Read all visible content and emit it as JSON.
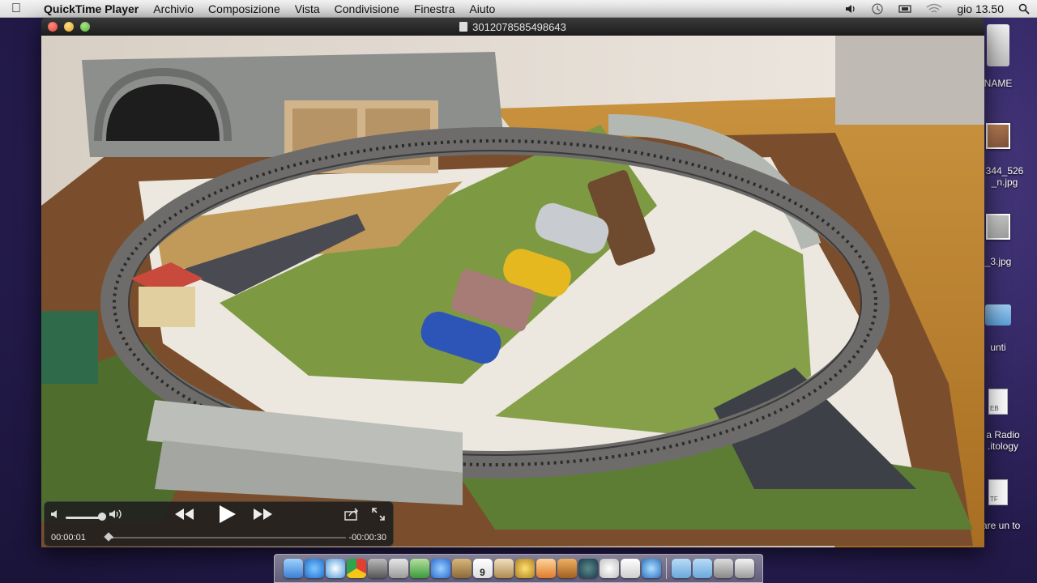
{
  "menubar": {
    "app_name": "QuickTime Player",
    "items": [
      "Archivio",
      "Composizione",
      "Vista",
      "Condivisione",
      "Finestra",
      "Aiuto"
    ],
    "clock": "gio 13.50"
  },
  "window": {
    "title": "3012078585498643"
  },
  "player": {
    "time_elapsed": "00:00:01",
    "time_remaining": "-00:00:30",
    "volume_level": 0.95,
    "progress": 0.03
  },
  "desktop": {
    "items": [
      {
        "label": "NAME",
        "kind": "hidden"
      },
      {
        "label": "344_526 _n.jpg",
        "kind": "thumb"
      },
      {
        "label": "_3.jpg",
        "kind": "thumb"
      },
      {
        "label": "unti",
        "kind": "folder"
      },
      {
        "label": "a Radio .itology",
        "kind": "doc"
      },
      {
        "label": "fare un to",
        "kind": "doc"
      }
    ]
  },
  "dock": {
    "apps": [
      "finder-icon",
      "app-store-icon",
      "safari-icon",
      "chrome-icon",
      "photo-booth-icon",
      "calculator-icon",
      "facetime-icon",
      "itunes-icon",
      "contacts-icon",
      "calendar-icon",
      "preview-icon",
      "imovie-icon",
      "iphoto-icon",
      "garageband-icon",
      "time-machine-icon",
      "game-icon",
      "textedit-icon",
      "quicktime-icon",
      "documents-folder-icon",
      "applications-folder-icon",
      "downloads-icon",
      "trash-icon"
    ],
    "calendar_day": "9"
  },
  "colors": {
    "accent": "#4a8fd8",
    "close": "#e0443e",
    "minimize": "#dea123",
    "zoom": "#58b23a"
  }
}
